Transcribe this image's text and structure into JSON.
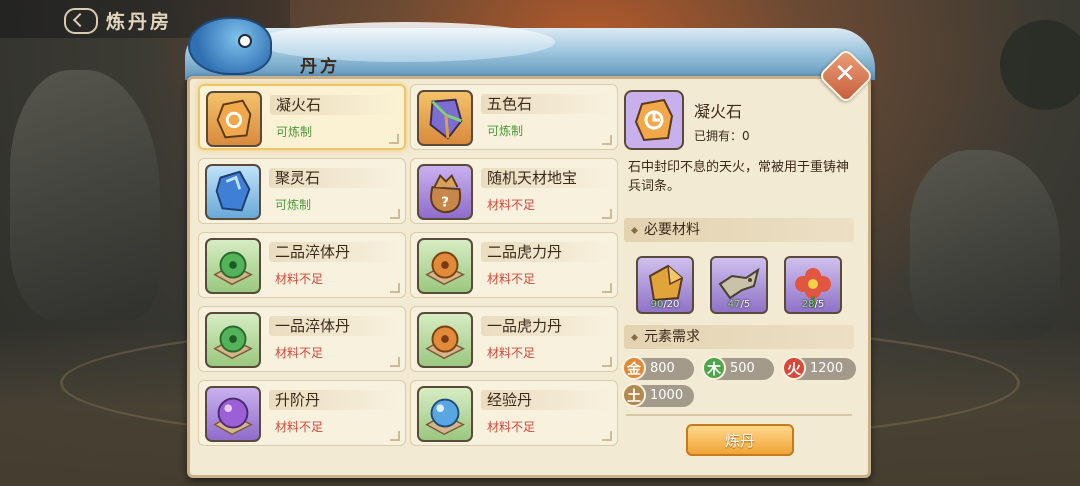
{
  "header": {
    "title": "炼丹房"
  },
  "banner": {
    "title": "丹方"
  },
  "recipes": [
    {
      "name": "凝火石",
      "status": "可炼制",
      "available": true,
      "icon": "fire-stone-icon",
      "selected": true
    },
    {
      "name": "五色石",
      "status": "可炼制",
      "available": true,
      "icon": "five-color-stone-icon"
    },
    {
      "name": "聚灵石",
      "status": "可炼制",
      "available": true,
      "icon": "spirit-stone-icon"
    },
    {
      "name": "随机天材地宝",
      "status": "材料不足",
      "available": false,
      "icon": "treasure-bag-icon"
    },
    {
      "name": "二品淬体丹",
      "status": "材料不足",
      "available": false,
      "icon": "green-pill-icon"
    },
    {
      "name": "二品虎力丹",
      "status": "材料不足",
      "available": false,
      "icon": "orange-pill-icon"
    },
    {
      "name": "一品淬体丹",
      "status": "材料不足",
      "available": false,
      "icon": "green-pill-icon"
    },
    {
      "name": "一品虎力丹",
      "status": "材料不足",
      "available": false,
      "icon": "orange-pill-icon"
    },
    {
      "name": "升阶丹",
      "status": "材料不足",
      "available": false,
      "icon": "purple-pill-icon"
    },
    {
      "name": "经验丹",
      "status": "材料不足",
      "available": false,
      "icon": "blue-pill-icon"
    }
  ],
  "detail": {
    "name": "凝火石",
    "owned_label": "已拥有：0",
    "description": "石中封印不息的天火，常被用于重铸神兵词条。",
    "materials_title": "必要材料",
    "materials": [
      {
        "have": "90",
        "need": "/20",
        "icon": "ore-chunk-icon"
      },
      {
        "have": "47",
        "need": "/5",
        "icon": "bone-material-icon"
      },
      {
        "have": "28",
        "need": "/5",
        "icon": "red-flower-icon"
      }
    ],
    "elements_title": "元素需求",
    "elements": [
      {
        "label": "金",
        "value": "800",
        "color": "#e08a3a"
      },
      {
        "label": "木",
        "value": "500",
        "color": "#4ea64a"
      },
      {
        "label": "火",
        "value": "1200",
        "color": "#d9473a"
      },
      {
        "label": "土",
        "value": "1000",
        "color": "#b08a50"
      }
    ],
    "craft_button": "炼丹"
  },
  "colors": {
    "available": "#4f9a3a",
    "unavailable": "#d04a3a",
    "panel": "#f3ead3"
  }
}
